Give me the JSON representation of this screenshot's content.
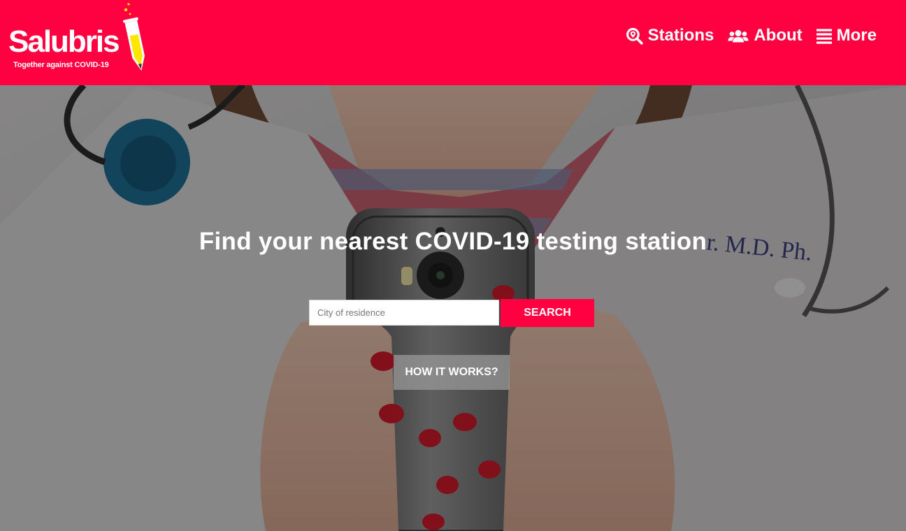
{
  "brand": {
    "name": "Salubris",
    "tagline": "Together against COVID-19",
    "accent_color": "#ff0040"
  },
  "nav": {
    "items": [
      {
        "label": "Stations",
        "icon": "map-search-icon"
      },
      {
        "label": "About",
        "icon": "users-icon"
      },
      {
        "label": "More",
        "icon": "list-icon"
      }
    ]
  },
  "hero": {
    "headline": "Find your nearest COVID-19 testing station",
    "search": {
      "placeholder": "City of residence",
      "value": "",
      "button_label": "SEARCH"
    },
    "how_it_works_label": "HOW IT WORKS?",
    "background_image": "doctor-holding-smartphone-photo"
  }
}
